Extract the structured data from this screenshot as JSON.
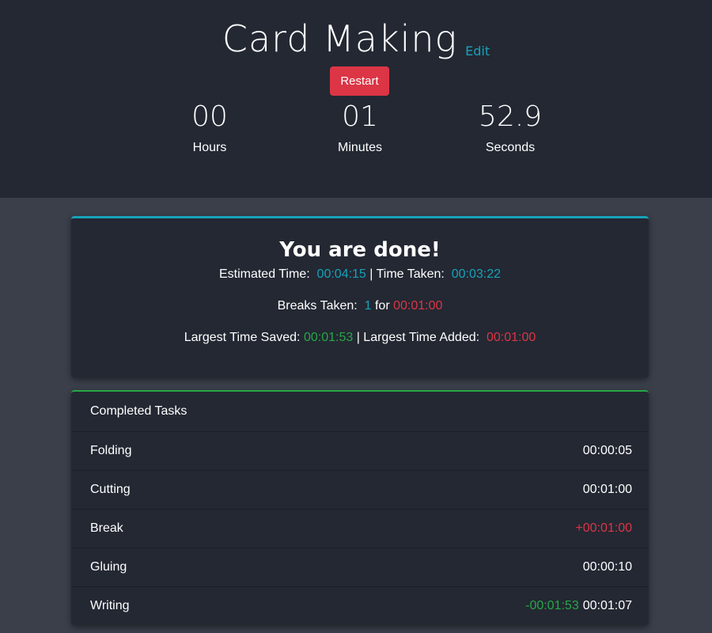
{
  "header": {
    "title": "Card Making",
    "edit_label": "Edit",
    "restart_label": "Restart",
    "timer": {
      "hours": "00",
      "hours_label": "Hours",
      "minutes": "01",
      "minutes_label": "Minutes",
      "seconds": "52.9",
      "seconds_label": "Seconds"
    }
  },
  "summary": {
    "heading": "You are done!",
    "estimated_label": "Estimated Time:",
    "estimated_value": "00:04:15",
    "separator": "|",
    "taken_label": "Time Taken:",
    "taken_value": "00:03:22",
    "breaks_label": "Breaks Taken:",
    "breaks_count": "1",
    "breaks_for": "for",
    "breaks_duration": "00:01:00",
    "saved_label": "Largest Time Saved:",
    "saved_value": "00:01:53",
    "added_label": "Largest Time Added:",
    "added_value": "00:01:00"
  },
  "tasks": {
    "header": "Completed Tasks",
    "items": [
      {
        "name": "Folding",
        "time": "00:00:05",
        "delta": ""
      },
      {
        "name": "Cutting",
        "time": "00:01:00",
        "delta": ""
      },
      {
        "name": "Break",
        "time": "",
        "delta": "+00:01:00"
      },
      {
        "name": "Gluing",
        "time": "00:00:10",
        "delta": ""
      },
      {
        "name": "Writing",
        "time": "00:01:07",
        "delta": "-00:01:53"
      }
    ]
  },
  "colors": {
    "accent": "#17a2b8",
    "danger": "#dc3545",
    "success": "#28a745",
    "background": "#3a3f4a",
    "panel": "#232833"
  }
}
